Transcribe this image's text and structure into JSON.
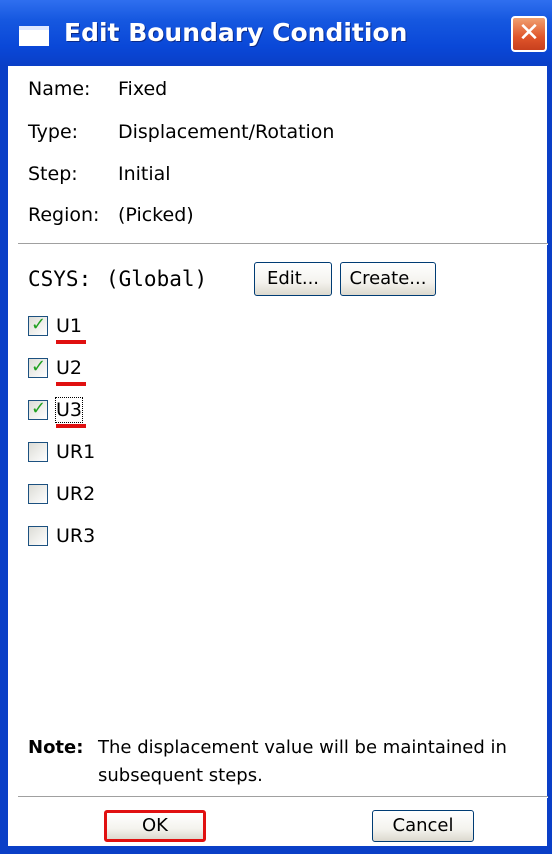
{
  "window": {
    "title": "Edit Boundary Condition",
    "close_glyph": "✕"
  },
  "info": {
    "name_label": "Name:",
    "name_value": "Fixed",
    "type_label": "Type:",
    "type_value": "Displacement/Rotation",
    "step_label": "Step:",
    "step_value": "Initial",
    "region_label": "Region:",
    "region_value": "(Picked)"
  },
  "csys": {
    "label": "CSYS:",
    "value": "(Global)",
    "edit_label": "Edit...",
    "create_label": "Create..."
  },
  "dofs": [
    {
      "label": "U1",
      "checked": true,
      "check_glyph": "✓"
    },
    {
      "label": "U2",
      "checked": true,
      "check_glyph": "✓"
    },
    {
      "label": "U3",
      "checked": true,
      "check_glyph": "✓"
    },
    {
      "label": "UR1",
      "checked": false,
      "check_glyph": ""
    },
    {
      "label": "UR2",
      "checked": false,
      "check_glyph": ""
    },
    {
      "label": "UR3",
      "checked": false,
      "check_glyph": ""
    }
  ],
  "note": {
    "label": "Note:",
    "text": "The displacement value will be maintained in subsequent steps."
  },
  "buttons": {
    "ok_label": "OK",
    "cancel_label": "Cancel"
  },
  "colors": {
    "titlebar": "#0a3fc7",
    "check": "#21a121",
    "highlight": "#e01010"
  }
}
